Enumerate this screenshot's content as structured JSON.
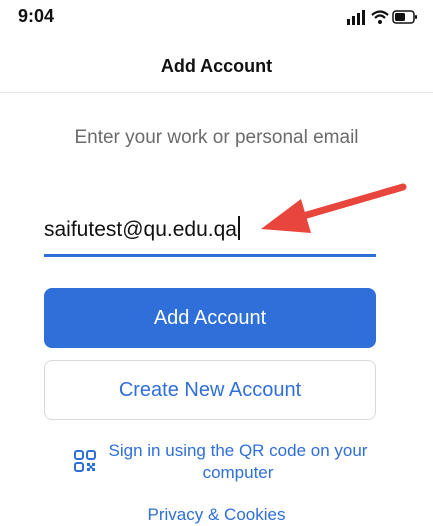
{
  "status_bar": {
    "time": "9:04",
    "icons": [
      "signal-icon",
      "wifi-icon",
      "battery-icon"
    ]
  },
  "nav": {
    "title": "Add Account"
  },
  "form": {
    "prompt": "Enter your work or personal email",
    "email_value": "saifutest@qu.edu.qa"
  },
  "buttons": {
    "add_account": "Add Account",
    "create_new_account": "Create New Account"
  },
  "qr_signin": {
    "label": "Sign in using the QR code on your computer",
    "icon": "qr-code-icon"
  },
  "footer": {
    "privacy_link": "Privacy & Cookies"
  },
  "colors": {
    "accent": "#2f6fd9",
    "annotation_arrow": "#e8453c",
    "prompt_text": "#6b6b6b"
  }
}
